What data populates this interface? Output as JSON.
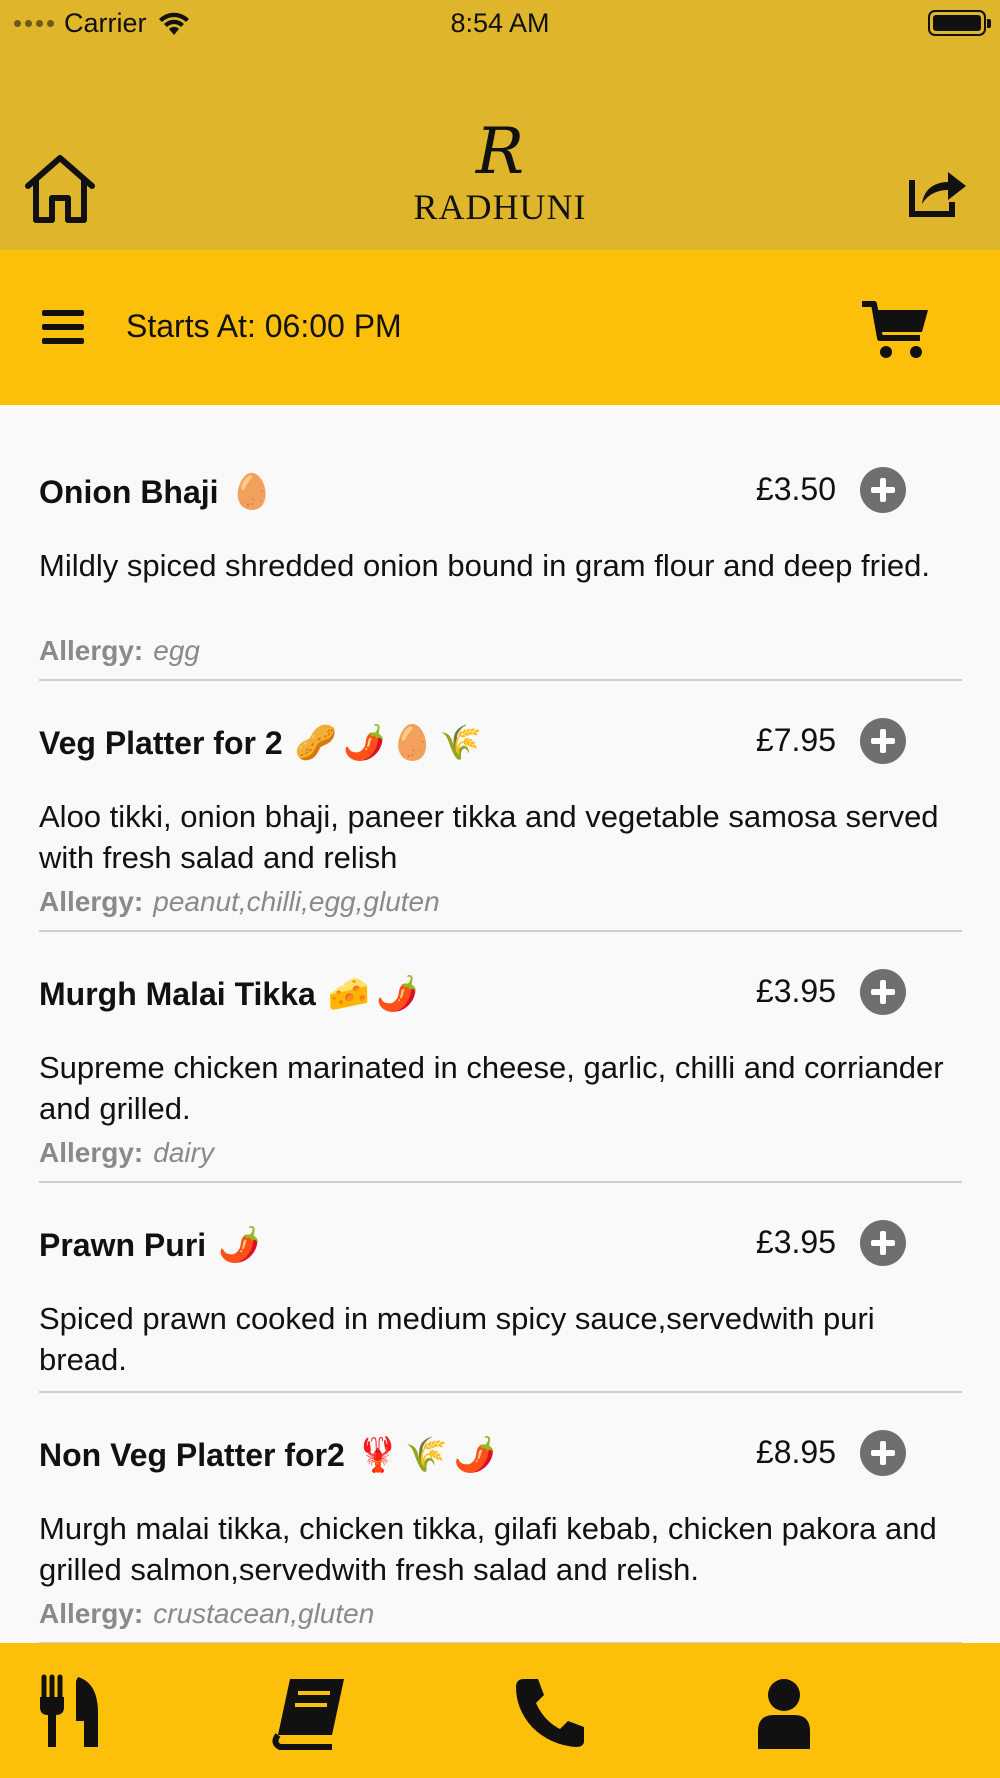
{
  "status_bar": {
    "carrier": "Carrier",
    "time": "8:54 AM"
  },
  "header": {
    "logo_mark": "R",
    "logo_text": "RADHUNI"
  },
  "subheader": {
    "starts_at": "Starts At: 06:00 PM"
  },
  "menu_items": [
    {
      "name": "Onion Bhaji",
      "icons": [
        "🥚"
      ],
      "price": "£3.50",
      "description": "Mildly spiced shredded onion bound in gram flour and deep fried.",
      "allergy_label": "Allergy:",
      "allergy": "egg"
    },
    {
      "name": "Veg Platter for 2",
      "icons": [
        "🥜",
        "🌶️",
        "🥚",
        "🌾"
      ],
      "price": "£7.95",
      "description": "Aloo tikki, onion bhaji, paneer tikka and vegetable samosa served with fresh salad and relish",
      "allergy_label": "Allergy:",
      "allergy": "peanut,chilli,egg,gluten"
    },
    {
      "name": "Murgh Malai Tikka",
      "icons": [
        "🧀",
        "🌶️"
      ],
      "price": "£3.95",
      "description": "Supreme chicken marinated in cheese, garlic, chilli and corriander and grilled.",
      "allergy_label": "Allergy:",
      "allergy": "dairy"
    },
    {
      "name": "Prawn Puri",
      "icons": [
        "🌶️"
      ],
      "price": "£3.95",
      "description": "Spiced prawn cooked in medium spicy sauce,servedwith puri bread.",
      "allergy_label": "",
      "allergy": ""
    },
    {
      "name": "Non Veg Platter for2",
      "icons": [
        "🦞",
        "🌾",
        "🌶️"
      ],
      "price": "£8.95",
      "description": "Murgh malai tikka, chicken tikka, gilafi kebab, chicken pakora and grilled salmon,servedwith fresh salad and relish.",
      "allergy_label": "Allergy:",
      "allergy": "crustacean,gluten"
    }
  ],
  "icons": {
    "home": "home-icon",
    "share": "share-icon",
    "menu": "hamburger-menu-icon",
    "cart": "shopping-cart-icon",
    "add": "plus-circle-icon",
    "tabs": [
      "fork-knife-icon",
      "book-icon",
      "phone-icon",
      "user-icon"
    ]
  },
  "colors": {
    "header_bg": "#deb52b",
    "accent": "#fdc00a",
    "add_button": "#6f6f72",
    "allergy_text": "#8a8a8d"
  }
}
